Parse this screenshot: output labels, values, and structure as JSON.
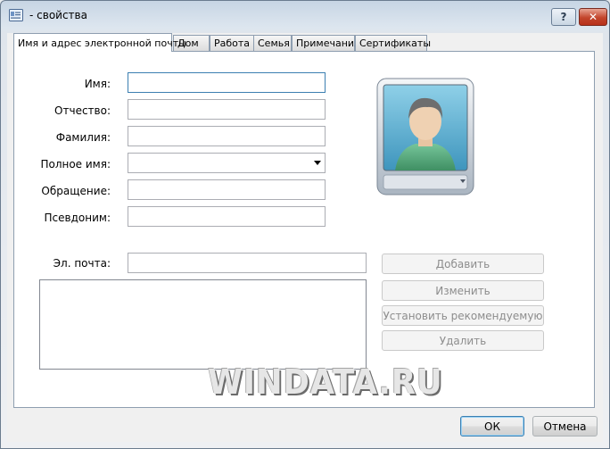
{
  "window": {
    "title": "- свойства",
    "help_label": "?",
    "close_label": "✕"
  },
  "tabs": [
    {
      "label": "Имя и адрес электронной почты",
      "active": true
    },
    {
      "label": "Дом"
    },
    {
      "label": "Работа"
    },
    {
      "label": "Семья"
    },
    {
      "label": "Примечания"
    },
    {
      "label": "Сертификаты"
    }
  ],
  "form": {
    "first_name_label": "Имя:",
    "first_name_value": "",
    "middle_name_label": "Отчество:",
    "middle_name_value": "",
    "last_name_label": "Фамилия:",
    "last_name_value": "",
    "full_name_label": "Полное имя:",
    "full_name_value": "",
    "title_label": "Обращение:",
    "title_value": "",
    "nickname_label": "Псевдоним:",
    "nickname_value": "",
    "email_label": "Эл. почта:",
    "email_value": ""
  },
  "email_buttons": {
    "add": "Добавить",
    "edit": "Изменить",
    "set_preferred": "Установить рекомендуемую",
    "remove": "Удалить"
  },
  "footer": {
    "ok": "ОК",
    "cancel": "Отмена"
  },
  "watermark": "WINDATA.RU",
  "icons": {
    "window_icon": "contact-card-icon",
    "photo_icon": "user-silhouette-icon",
    "photo_dropdown": "chevron-down-icon"
  },
  "colors": {
    "title_gradient_top": "#c7d5e4",
    "close_button": "#c2452c",
    "focus_border": "#3c7fb1",
    "avatar_bg": "#5fb0cf"
  }
}
